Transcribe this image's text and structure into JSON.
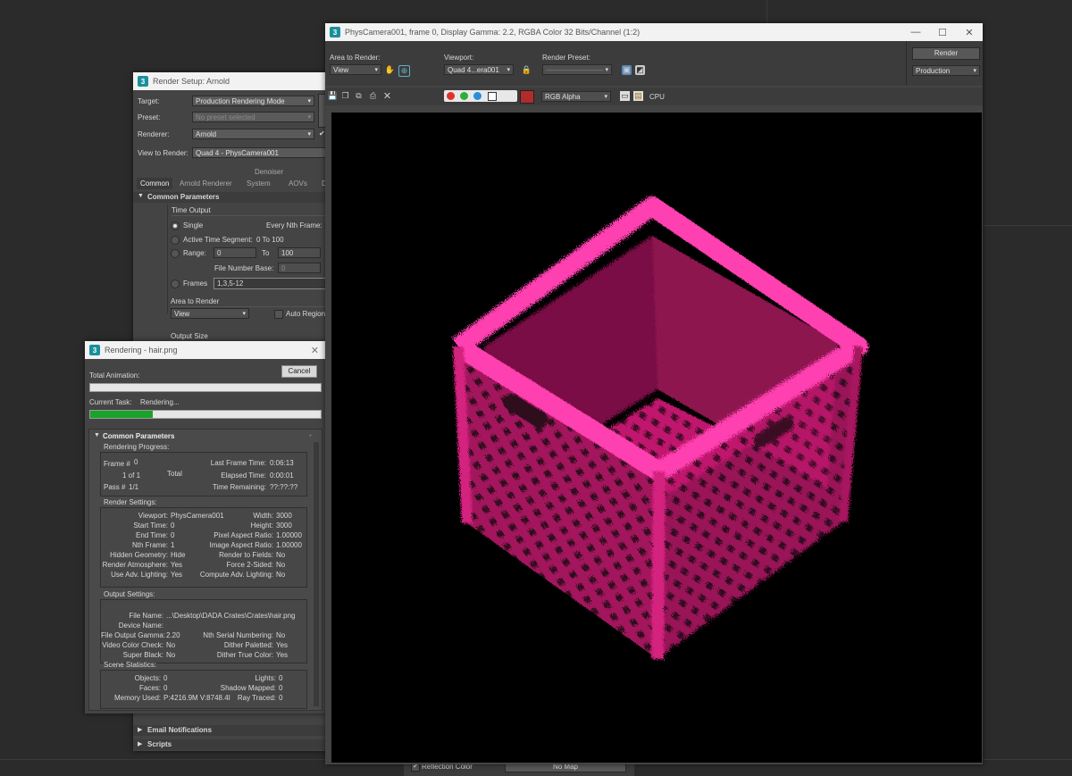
{
  "render_setup": {
    "title": "Render Setup: Arnold",
    "target_label": "Target:",
    "target_value": "Production Rendering Mode",
    "preset_label": "Preset:",
    "preset_value": "No preset selected",
    "renderer_label": "Renderer:",
    "renderer_value": "Arnold",
    "view_label": "View to Render:",
    "view_value": "Quad 4 - PhysCamera001",
    "denoiser": "Denoiser",
    "tabs": [
      "Common",
      "Arnold Renderer",
      "System",
      "AOVs",
      "D"
    ],
    "common_params": "Common Parameters",
    "time_output": "Time Output",
    "single": "Single",
    "every_nth": "Every Nth Frame:",
    "active_segment": "Active Time Segment:",
    "active_range": "0 To 100",
    "range_label": "Range:",
    "range_from": "0",
    "range_to_label": "To",
    "range_to": "100",
    "file_number_base": "File Number Base:",
    "file_number_value": "0",
    "frames_label": "Frames",
    "frames_value": "1,3,5-12",
    "area_to_render": "Area to Render",
    "area_value": "View",
    "auto_region": "Auto Region",
    "output_size": "Output Size",
    "email": "Email Notifications",
    "scripts": "Scripts"
  },
  "rendering": {
    "title": "Rendering - hair.png",
    "cancel": "Cancel",
    "total_animation": "Total Animation:",
    "current_task_label": "Current Task:",
    "current_task_value": "Rendering...",
    "total_progress": 0,
    "task_progress": 0.27,
    "common_params": "Common Parameters",
    "progress_section": "Rendering Progress:",
    "frame_label": "Frame #",
    "frame_value": "0",
    "frame_count": "1 of 1",
    "total": "Total",
    "pass_label": "Pass #",
    "pass_value": "1/1",
    "last_frame_time_label": "Last Frame Time:",
    "last_frame_time": "0:06:13",
    "elapsed_label": "Elapsed Time:",
    "elapsed": "0:00:01",
    "remaining_label": "Time Remaining:",
    "remaining": "??:??:??",
    "render_settings": "Render Settings:",
    "viewport_label": "Viewport:",
    "viewport": "PhysCamera001",
    "width_label": "Width:",
    "width": "3000",
    "start_label": "Start Time:",
    "start": "0",
    "height_label": "Height:",
    "height": "3000",
    "end_label": "End Time:",
    "end": "0",
    "pixel_aspect_label": "Pixel Aspect Ratio:",
    "pixel_aspect": "1.00000",
    "nth_label": "Nth Frame:",
    "nth": "1",
    "image_aspect_label": "Image Aspect Ratio:",
    "image_aspect": "1.00000",
    "hidden_geo_label": "Hidden Geometry:",
    "hidden_geo": "Hide",
    "render_fields_label": "Render to Fields:",
    "render_fields": "No",
    "atmosphere_label": "Render Atmosphere:",
    "atmosphere": "Yes",
    "force2_label": "Force 2-Sided:",
    "force2": "No",
    "adv_light_label": "Use Adv. Lighting:",
    "adv_light": "Yes",
    "compute_adv_label": "Compute Adv. Lighting:",
    "compute_adv": "No",
    "output_settings": "Output Settings:",
    "file_name_label": "File Name:",
    "file_name": "...\\Desktop\\DADA Crates\\Crates\\hair.png",
    "device_label": "Device Name:",
    "gamma_label": "File Output Gamma:",
    "gamma": "2.20",
    "nth_serial_label": "Nth Serial Numbering:",
    "nth_serial": "No",
    "video_check_label": "Video Color Check:",
    "video_check": "No",
    "dither_pal_label": "Dither Paletted:",
    "dither_pal": "Yes",
    "super_black_label": "Super Black:",
    "super_black": "No",
    "dither_true_label": "Dither True Color:",
    "dither_true": "Yes",
    "scene_stats": "Scene Statistics:",
    "objects_label": "Objects:",
    "objects": "0",
    "lights_label": "Lights:",
    "lights": "0",
    "faces_label": "Faces:",
    "faces": "0",
    "shadow_label": "Shadow Mapped:",
    "shadow": "0",
    "memory_label": "Memory Used:",
    "memory": "P:4216.9M V:8748.4I",
    "ray_label": "Ray Traced:",
    "ray": "0"
  },
  "frame_window": {
    "title": "PhysCamera001, frame 0, Display Gamma: 2.2, RGBA Color 32 Bits/Channel (1:2)",
    "area_label": "Area to Render:",
    "area_value": "View",
    "viewport_label": "Viewport:",
    "viewport_value": "Quad 4...era001",
    "preset_label": "Render Preset:",
    "render_button": "Render",
    "mode_value": "Production",
    "channel_value": "RGB Alpha",
    "cpu": "CPU",
    "channel_colors": [
      "#e0312d",
      "#2fae3a",
      "#2a8fd8"
    ],
    "swatch_color": "#b22b2b"
  },
  "background": {
    "reflection_color": "Reflection Color",
    "no_map": "No Map"
  }
}
